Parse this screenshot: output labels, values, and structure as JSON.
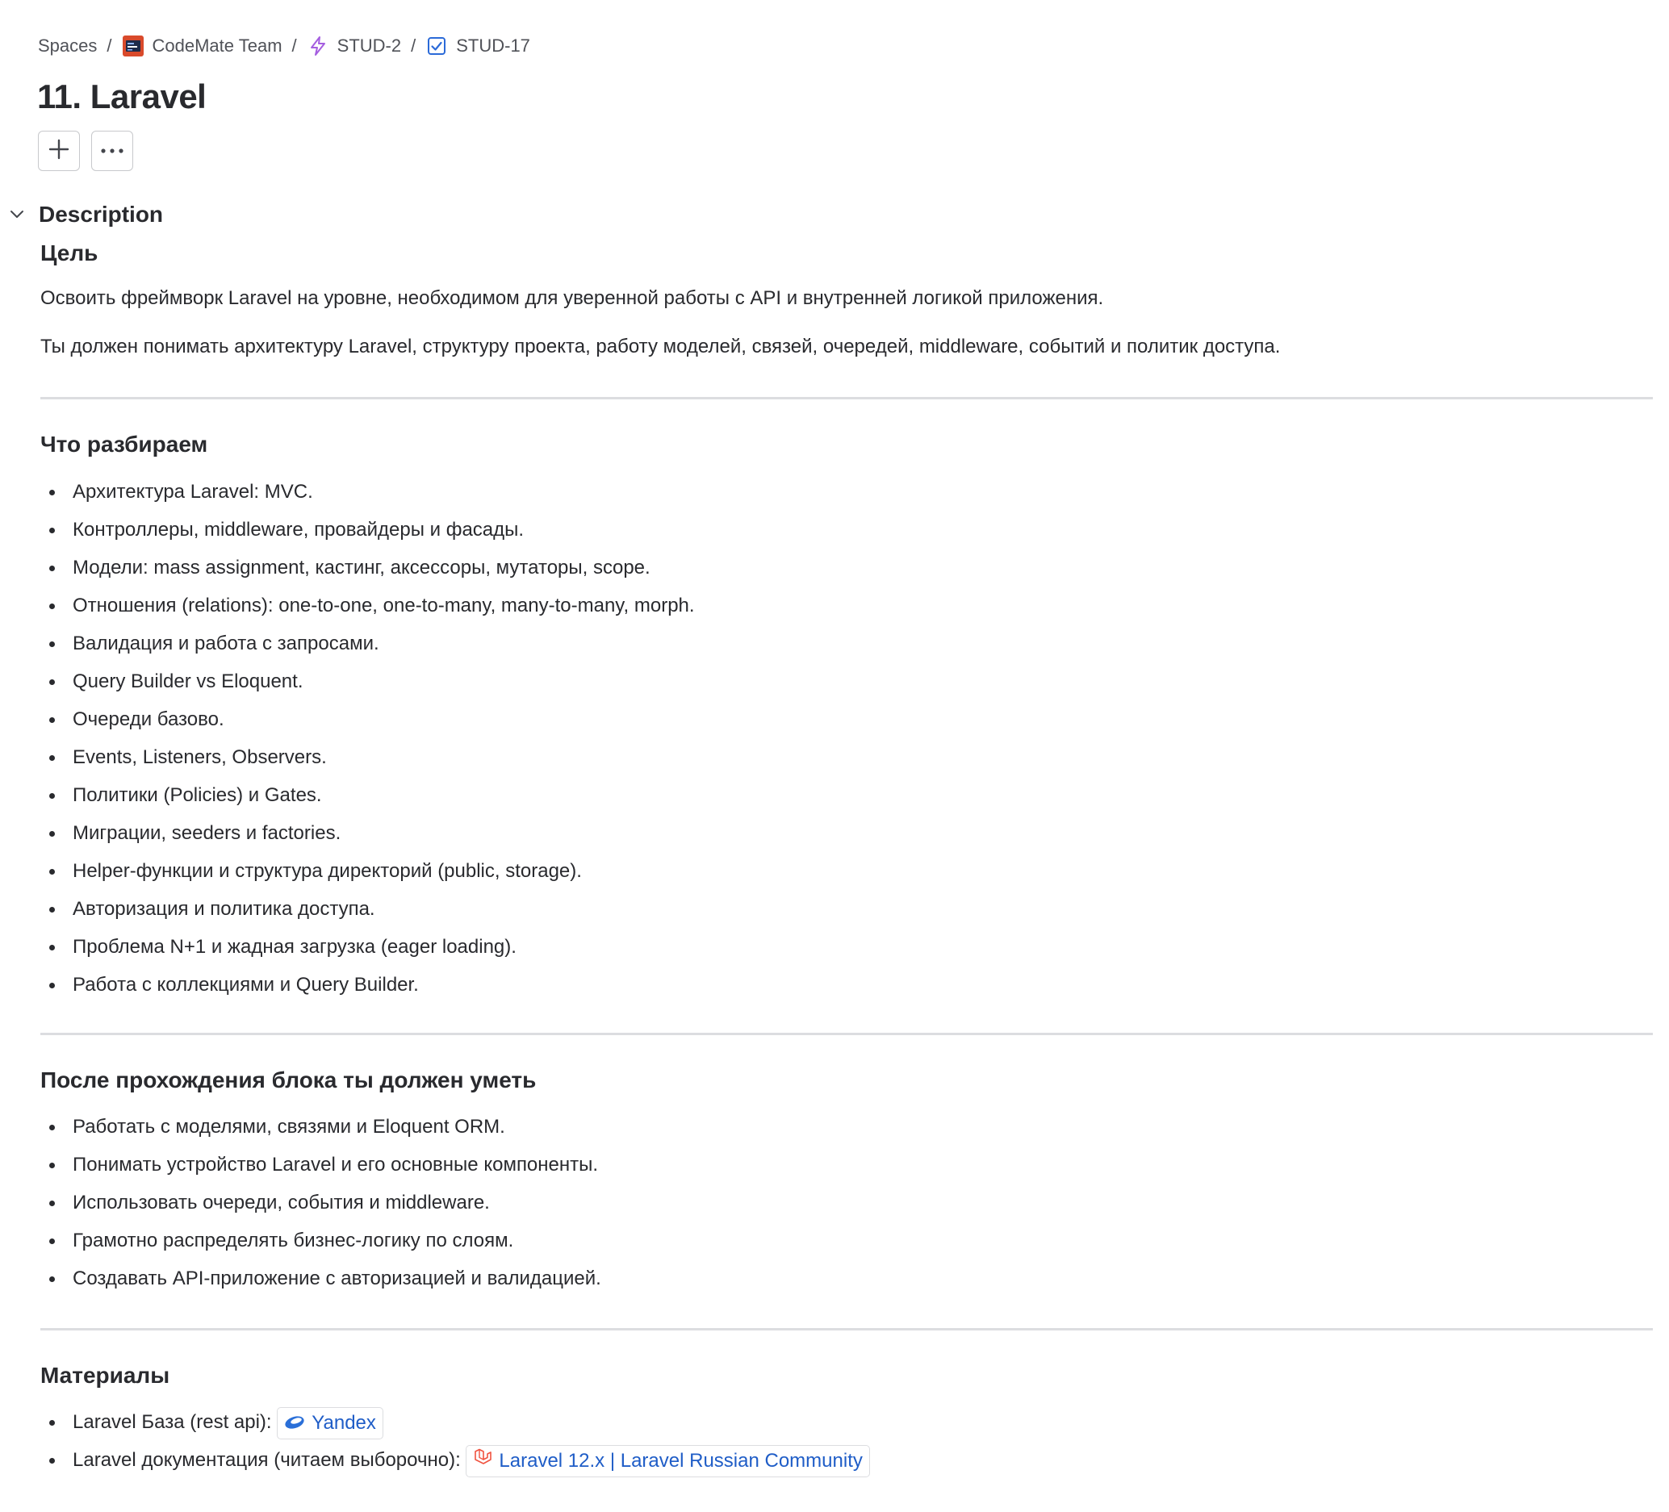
{
  "breadcrumbs": [
    {
      "label": "Spaces"
    },
    {
      "label": "CodeMate Team",
      "icon": "project-avatar-icon"
    },
    {
      "label": "STUD-2",
      "icon": "epic-lightning-icon"
    },
    {
      "label": "STUD-17",
      "icon": "task-checkbox-icon"
    }
  ],
  "breadcrumb_separator": "/",
  "title": "11. Laravel",
  "actions": {
    "add": "add-icon",
    "more": "more-icon"
  },
  "description": {
    "label": "Description",
    "goal": {
      "heading": "Цель",
      "paragraphs": [
        "Освоить фреймворк Laravel на уровне, необходимом для уверенной работы с API и внутренней логикой приложения.",
        "Ты должен понимать архитектуру Laravel, структуру проекта, работу моделей, связей, очередей, middleware, событий и политик доступа."
      ]
    },
    "topics": {
      "heading": "Что разбираем",
      "items": [
        "Архитектура Laravel: MVC.",
        "Контроллеры, middleware, провайдеры и фасады.",
        "Модели: mass assignment, кастинг, аксессоры, мутаторы, scope.",
        "Отношения (relations): one-to-one, one-to-many, many-to-many, morph.",
        "Валидация и работа с запросами.",
        "Query Builder vs Eloquent.",
        "Очереди базово.",
        "Events, Listeners, Observers.",
        "Политики (Policies) и Gates.",
        "Миграции, seeders и factories.",
        "Helper-функции и структура директорий (public, storage).",
        "Авторизация и политика доступа.",
        "Проблема N+1 и жадная загрузка (eager loading).",
        "Работа с коллекциями и Query Builder."
      ]
    },
    "outcomes": {
      "heading": "После прохождения блока ты должен уметь",
      "items": [
        "Работать с моделями, связями и Eloquent ORM.",
        "Понимать устройство Laravel и его основные компоненты.",
        "Использовать очереди, события и middleware.",
        "Грамотно распределять бизнес-логику по слоям.",
        "Создавать API-приложение с авторизацией и валидацией."
      ]
    },
    "materials": {
      "heading": "Материалы",
      "items": [
        {
          "text": "Laravel База (rest api):",
          "link_label": "Yandex",
          "link_icon": "yandex-disk-icon"
        },
        {
          "text": "Laravel документация (читаем выборочно):",
          "link_label": "Laravel 12.x | Laravel Russian Community",
          "link_icon": "laravel-logo-icon"
        }
      ]
    }
  },
  "colors": {
    "text": "#292a2e",
    "muted": "#505258",
    "link": "#1f5dc7",
    "divider": "#dcdde0"
  }
}
